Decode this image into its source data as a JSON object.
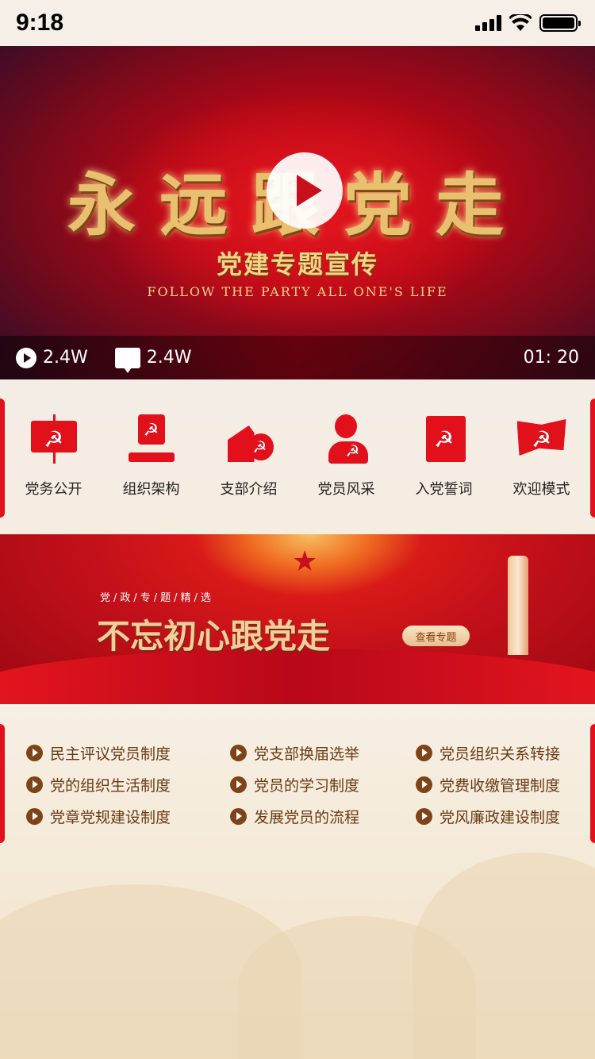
{
  "status": {
    "time": "9:18"
  },
  "video": {
    "title": "永远跟党走",
    "subtitle": "党建专题宣传",
    "english": "FOLLOW THE PARTY ALL ONE'S LIFE",
    "plays": "2.4W",
    "comments": "2.4W",
    "duration": "01: 20"
  },
  "menu": [
    {
      "label": "党务公开",
      "icon": "easel-icon"
    },
    {
      "label": "组织架构",
      "icon": "org-chart-icon"
    },
    {
      "label": "支部介绍",
      "icon": "building-icon"
    },
    {
      "label": "党员风采",
      "icon": "member-icon"
    },
    {
      "label": "入党誓词",
      "icon": "book-icon"
    },
    {
      "label": "欢迎模式",
      "icon": "flag-icon"
    }
  ],
  "banner": {
    "tagline": "党/政/专/题/精/选",
    "title": "不忘初心跟党走",
    "button": "查看专题"
  },
  "links": [
    [
      "民主评议党员制度",
      "党支部换届选举",
      "党员组织关系转接"
    ],
    [
      "党的组织生活制度",
      "党员的学习制度",
      "党费收缴管理制度"
    ],
    [
      "党章党规建设制度",
      "发展党员的流程",
      "党风廉政建设制度"
    ]
  ],
  "colors": {
    "accent": "#e1101b",
    "link": "#6a3a12",
    "bullet": "#7e4316"
  }
}
